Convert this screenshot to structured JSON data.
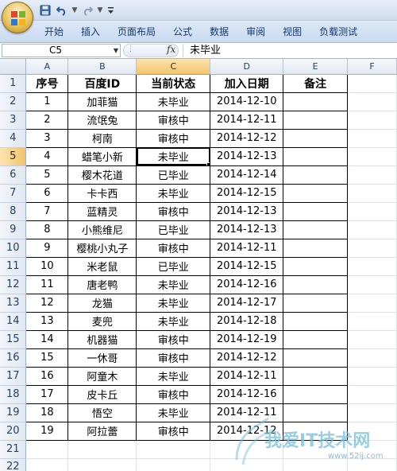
{
  "ribbon": {
    "tabs": [
      "开始",
      "插入",
      "页面布局",
      "公式",
      "数据",
      "审阅",
      "视图",
      "负载测试"
    ]
  },
  "formula_bar": {
    "name_box": "C5",
    "fx_label": "fx",
    "content": "未毕业"
  },
  "sheet": {
    "columns": [
      "A",
      "B",
      "C",
      "D",
      "E",
      "F"
    ],
    "active_column": "C",
    "active_row": 5,
    "headers": [
      "序号",
      "百度ID",
      "当前状态",
      "加入日期",
      "备注"
    ],
    "rows": [
      [
        "1",
        "加菲猫",
        "未毕业",
        "2014-12-10"
      ],
      [
        "2",
        "流氓兔",
        "审核中",
        "2014-12-11"
      ],
      [
        "3",
        "柯南",
        "审核中",
        "2014-12-12"
      ],
      [
        "4",
        "蜡笔小新",
        "未毕业",
        "2014-12-13"
      ],
      [
        "5",
        "樱木花道",
        "已毕业",
        "2014-12-14"
      ],
      [
        "6",
        "卡卡西",
        "未毕业",
        "2014-12-15"
      ],
      [
        "7",
        "蓝精灵",
        "审核中",
        "2014-12-13"
      ],
      [
        "8",
        "小熊维尼",
        "已毕业",
        "2014-12-13"
      ],
      [
        "9",
        "樱桃小丸子",
        "审核中",
        "2014-12-11"
      ],
      [
        "10",
        "米老鼠",
        "已毕业",
        "2014-12-15"
      ],
      [
        "11",
        "唐老鸭",
        "未毕业",
        "2014-12-16"
      ],
      [
        "12",
        "龙猫",
        "未毕业",
        "2014-12-17"
      ],
      [
        "13",
        "麦兜",
        "未毕业",
        "2014-12-18"
      ],
      [
        "14",
        "机器猫",
        "审核中",
        "2014-12-19"
      ],
      [
        "15",
        "一休哥",
        "审核中",
        "2014-12-12"
      ],
      [
        "16",
        "阿童木",
        "未毕业",
        "2014-12-11"
      ],
      [
        "17",
        "皮卡丘",
        "审核中",
        "2014-12-16"
      ],
      [
        "18",
        "悟空",
        "未毕业",
        "2014-12-11"
      ],
      [
        "19",
        "阿拉蕾",
        "审核中",
        "2014-12-12"
      ]
    ],
    "row_numbers": [
      "1",
      "2",
      "3",
      "4",
      "5",
      "6",
      "7",
      "8",
      "9",
      "10",
      "11",
      "12",
      "13",
      "14",
      "15",
      "16",
      "17",
      "18",
      "19",
      "20",
      "21",
      "22"
    ]
  },
  "watermark": {
    "text": "我爱IT技术网",
    "url": "www.52ij.com"
  },
  "colors": {
    "ribbon_text": "#15386f",
    "active_header": "#f2c46b",
    "grid_line": "#dfe3e8"
  },
  "icons": [
    "office-button-icon",
    "save-icon",
    "undo-icon",
    "redo-icon",
    "customize-qat-icon",
    "fx-icon"
  ]
}
